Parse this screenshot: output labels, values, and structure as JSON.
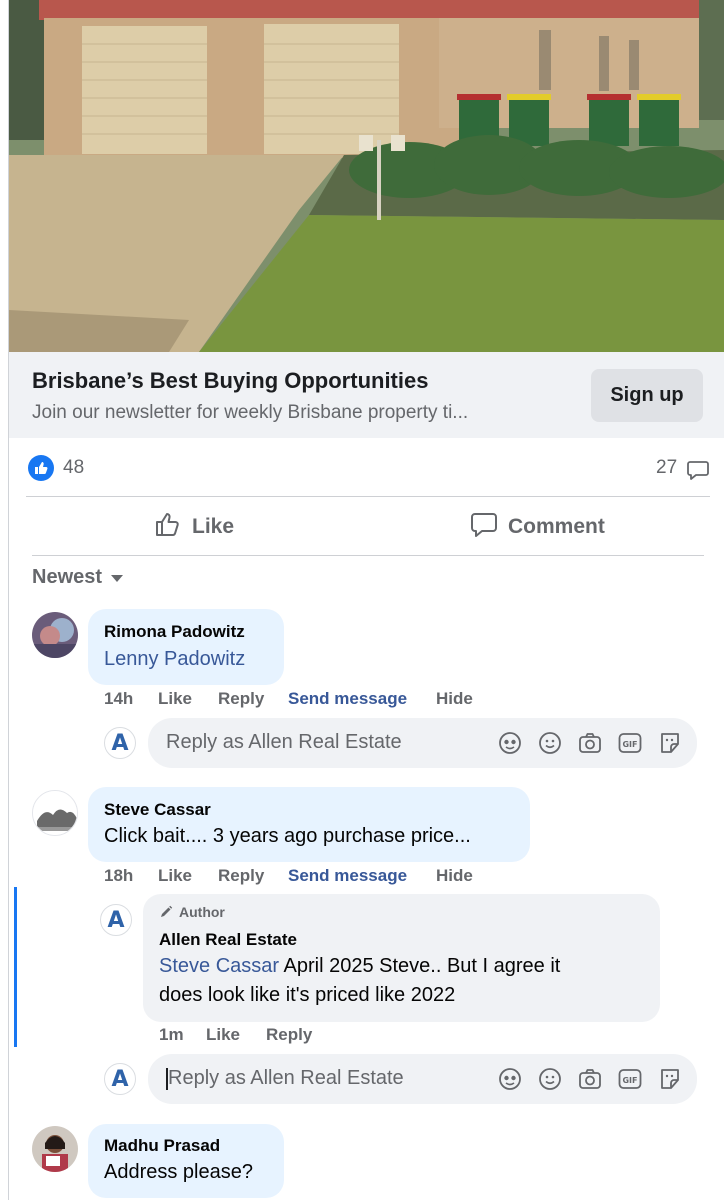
{
  "ad": {
    "title": "Brisbane’s Best Buying Opportunities",
    "subtitle": "Join our newsletter for weekly Brisbane property ti...",
    "cta": "Sign up"
  },
  "stats": {
    "likes": "48",
    "comments": "27"
  },
  "actions": {
    "like": "Like",
    "comment": "Comment"
  },
  "sort": {
    "label": "Newest"
  },
  "reply_placeholder": "Reply as Allen Real Estate",
  "page_avatar_letter": "A",
  "comments": [
    {
      "author": "Rimona Padowitz",
      "mention": "Lenny Padowitz",
      "text": "",
      "meta": {
        "time": "14h",
        "like": "Like",
        "reply": "Reply",
        "send": "Send message",
        "hide": "Hide"
      }
    },
    {
      "author": "Steve Cassar",
      "text": "Click bait.... 3 years ago purchase price...",
      "meta": {
        "time": "18h",
        "like": "Like",
        "reply": "Reply",
        "send": "Send message",
        "hide": "Hide"
      },
      "reply": {
        "badge": "Author",
        "author": "Allen Real Estate",
        "mention": "Steve Cassar",
        "text_line1": " April 2025 Steve.. But I agree it",
        "text_line2": "does look like it's priced like 2022",
        "meta": {
          "time": "1m",
          "like": "Like",
          "reply": "Reply"
        }
      }
    },
    {
      "author": "Madhu Prasad",
      "text": "Address please?"
    }
  ],
  "colors": {
    "accent": "#1877f2",
    "link": "#385898",
    "bubble": "#e7f3ff",
    "muted": "#65676b"
  }
}
